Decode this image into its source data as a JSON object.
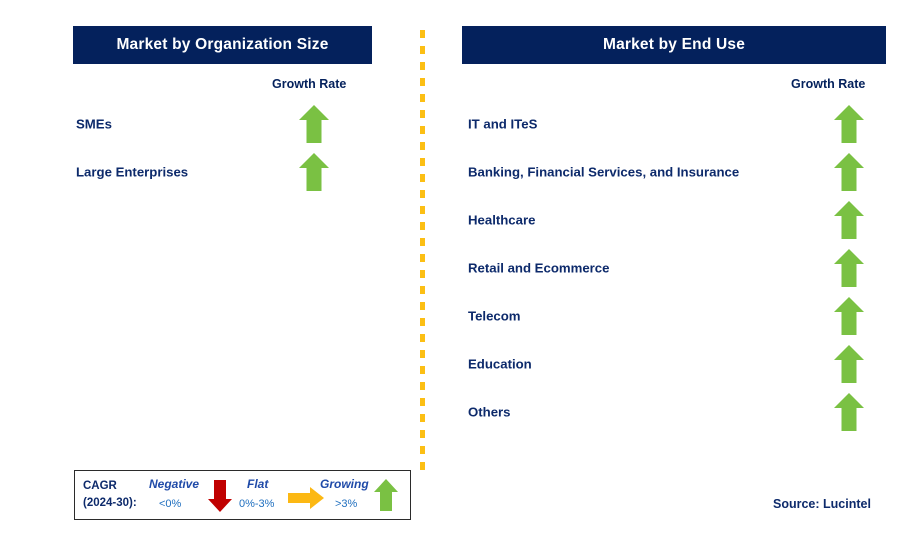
{
  "panels": [
    {
      "id": "organization-size",
      "title": "Market by Organization Size",
      "growth_caption": "Growth Rate",
      "segments": [
        {
          "label": "SMEs",
          "growth": "growing",
          "arrow_icon": "arrow-up-icon"
        },
        {
          "label": "Large Enterprises",
          "growth": "growing",
          "arrow_icon": "arrow-up-icon"
        }
      ]
    },
    {
      "id": "end-use",
      "title": "Market by End Use",
      "growth_caption": "Growth Rate",
      "segments": [
        {
          "label": "IT and ITeS",
          "growth": "growing",
          "arrow_icon": "arrow-up-icon"
        },
        {
          "label": "Banking, Financial Services, and Insurance",
          "growth": "growing",
          "arrow_icon": "arrow-up-icon"
        },
        {
          "label": "Healthcare",
          "growth": "growing",
          "arrow_icon": "arrow-up-icon"
        },
        {
          "label": "Retail and Ecommerce",
          "growth": "growing",
          "arrow_icon": "arrow-up-icon"
        },
        {
          "label": "Telecom",
          "growth": "growing",
          "arrow_icon": "arrow-up-icon"
        },
        {
          "label": "Education",
          "growth": "growing",
          "arrow_icon": "arrow-up-icon"
        },
        {
          "label": "Others",
          "growth": "growing",
          "arrow_icon": "arrow-up-icon"
        }
      ]
    }
  ],
  "legend": {
    "title_line1": "CAGR",
    "title_line2": "(2024-30):",
    "entries": [
      {
        "term": "Negative",
        "range": "<0%",
        "arrow_icon": "arrow-down-icon",
        "color": "#c00000"
      },
      {
        "term": "Flat",
        "range": "0%-3%",
        "arrow_icon": "arrow-right-icon",
        "color": "#fcb813"
      },
      {
        "term": "Growing",
        "range": ">3%",
        "arrow_icon": "arrow-up-icon",
        "color": "#7ac143"
      }
    ]
  },
  "source": "Source: Lucintel",
  "colors": {
    "header_navy": "#04215c",
    "label_navy": "#0d2a6b",
    "growing_green": "#7ac143",
    "negative_red": "#c00000",
    "flat_orange": "#fcb813",
    "divider_amber": "#fcbf14",
    "background": "#ffffff"
  }
}
